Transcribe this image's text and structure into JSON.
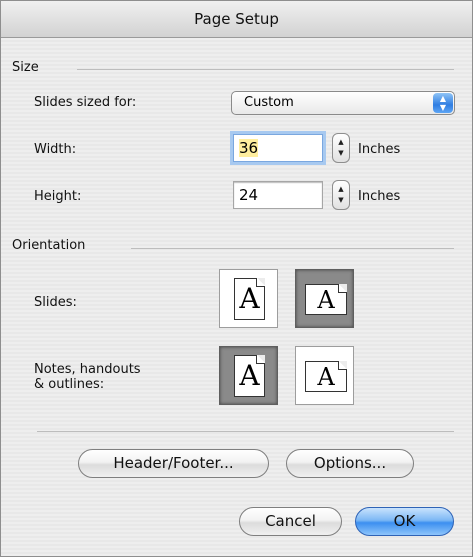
{
  "dialog": {
    "title": "Page Setup"
  },
  "size": {
    "section_label": "Size",
    "slides_sized_for_label": "Slides sized for:",
    "slides_sized_for_value": "Custom",
    "width_label": "Width:",
    "width_value": "36",
    "width_unit": "Inches",
    "height_label": "Height:",
    "height_value": "24",
    "height_unit": "Inches"
  },
  "orientation": {
    "section_label": "Orientation",
    "slides_label": "Slides:",
    "notes_label_line1": "Notes, handouts",
    "notes_label_line2": "& outlines:",
    "glyph": "A",
    "slides_selected": "landscape",
    "notes_selected": "portrait"
  },
  "buttons": {
    "header_footer": "Header/Footer...",
    "options": "Options...",
    "cancel": "Cancel",
    "ok": "OK"
  },
  "colors": {
    "default_button": "#3c8ff0",
    "focus_ring": "#a7c9f0",
    "selection_highlight": "#ffee9e"
  }
}
